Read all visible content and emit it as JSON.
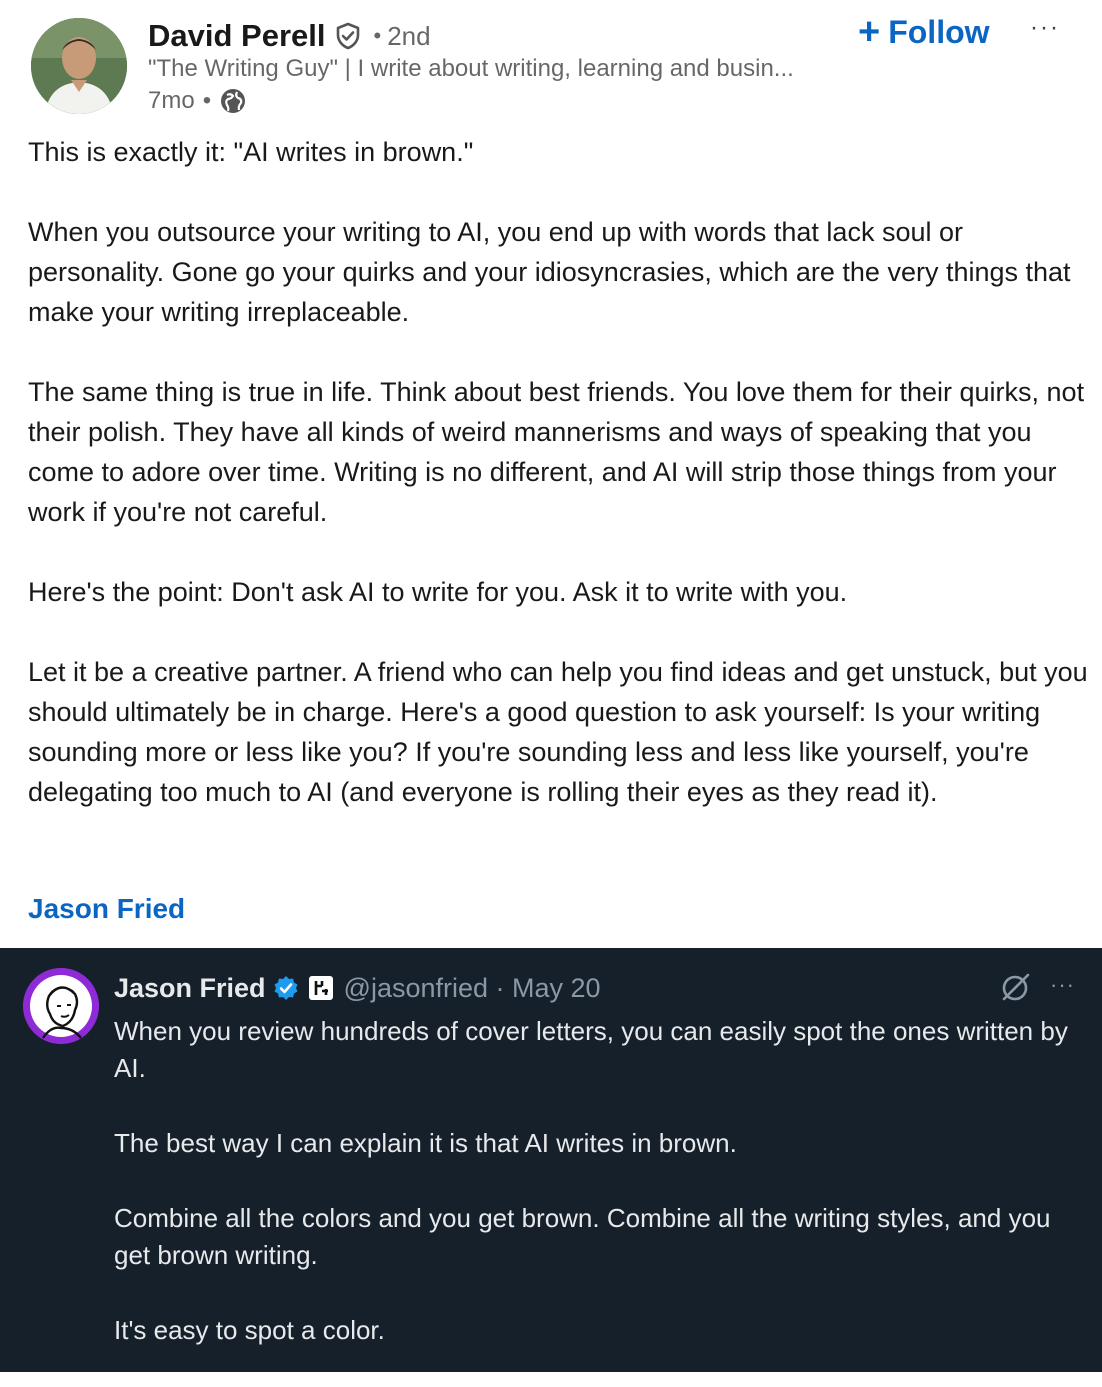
{
  "post": {
    "author": {
      "name": "David Perell",
      "degree_sep": "•",
      "degree": "2nd",
      "headline": "\"The Writing Guy\" | I write about writing, learning and busin...",
      "time": "7mo",
      "time_sep": "•",
      "visibility_icon": "globe-icon",
      "verified_icon": "verified-shield-icon"
    },
    "follow_label": "Follow",
    "follow_icon": "plus-icon",
    "more_label": "···",
    "paragraphs": [
      "This is exactly it: \"AI writes in brown.\"",
      "When you outsource your writing to AI, you end up with words that lack soul or personality. Gone go your quirks and your idiosyncrasies, which are the very things that make your writing irreplaceable.",
      "The same thing is true in life. Think about best friends. You love them for their quirks, not their polish. They have all kinds of weird mannerisms and ways of speaking that you come to adore over time. Writing is no different, and AI will strip those things from your work if you're not careful.",
      "Here's the point: Don't ask AI to write for you. Ask it to write with you.",
      "Let it be a creative partner. A friend who can help you find ideas and get unstuck, but you should ultimately be in charge. Here's a good question to ask yourself: Is your writing sounding more or less like you? If you're sounding less and less like yourself, you're delegating too much to AI (and everyone is rolling their eyes as they read it)."
    ],
    "mention": "Jason Fried"
  },
  "tweet": {
    "name": "Jason Fried",
    "handle": "@jasonfried · May 20",
    "verified_icon": "blue-check-icon",
    "org_icon": "company-logo-icon",
    "grok_icon": "grok-icon",
    "more_label": "···",
    "paragraphs": [
      "When you review hundreds of cover letters, you can easily spot the ones written by AI.",
      "The best way I can explain it is that AI writes in brown.",
      "Combine all the colors and you get brown. Combine all the writing styles, and you get brown writing.",
      "It's easy to spot a color."
    ]
  },
  "colors": {
    "link_blue": "#0a66c2",
    "tweet_bg": "#15202b",
    "tweet_badge": "#1d9bf0",
    "avatar_purple": "#8e2bd6"
  }
}
